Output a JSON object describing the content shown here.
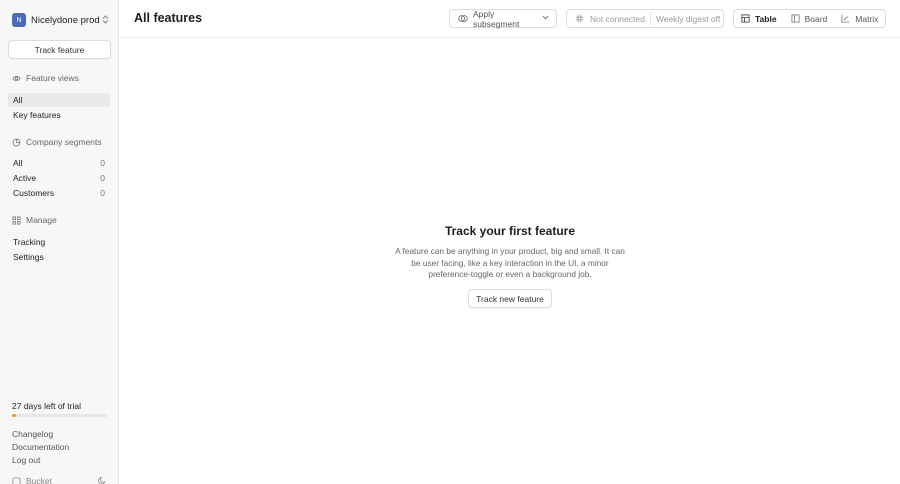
{
  "org": {
    "initial": "N",
    "name": "Nicelydone prod"
  },
  "sidebar": {
    "track_button": "Track feature",
    "feature_views_heading": "Feature views",
    "feature_views": [
      {
        "label": "All",
        "active": true
      },
      {
        "label": "Key features",
        "active": false
      }
    ],
    "segments_heading": "Company segments",
    "segments": [
      {
        "label": "All",
        "count": "0"
      },
      {
        "label": "Active",
        "count": "0"
      },
      {
        "label": "Customers",
        "count": "0"
      }
    ],
    "manage_heading": "Manage",
    "manage_items": [
      "Tracking",
      "Settings"
    ],
    "trial_text": "27 days left of trial",
    "trial_progress": 0.04,
    "footer_links": [
      "Changelog",
      "Documentation",
      "Log out"
    ],
    "brand": "Bucket"
  },
  "header": {
    "title": "All features",
    "subsegment_label": "Apply subsegment",
    "slack_status": "Not connected",
    "digest_status": "Weekly digest off",
    "views": [
      {
        "label": "Table",
        "active": true
      },
      {
        "label": "Board",
        "active": false
      },
      {
        "label": "Matrix",
        "active": false
      }
    ]
  },
  "empty_state": {
    "title": "Track your first feature",
    "description": "A feature can be anything in your product, big and small. It can be user facing, like a key interaction in the UI, a minor preference-toggle or even a background job.",
    "button": "Track new feature"
  },
  "colors": {
    "accent": "#4b6cb7",
    "trial": "#f29b25"
  },
  "icons": [
    "chevron-up-down-icon",
    "eye-icon",
    "segments-icon",
    "grid-icon",
    "bucket-icon",
    "moon-icon",
    "table-icon",
    "board-icon",
    "matrix-icon",
    "slack-icon"
  ]
}
